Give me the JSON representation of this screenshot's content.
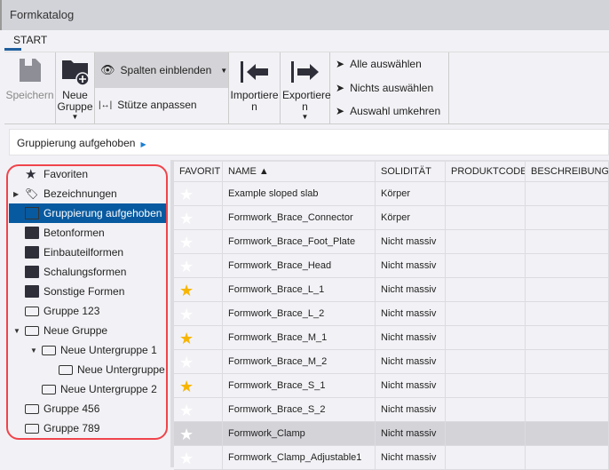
{
  "window": {
    "title": "Formkatalog"
  },
  "tabs": [
    {
      "label": "START"
    }
  ],
  "ribbon": {
    "save": "Speichern",
    "new_group": "Neue Gruppe",
    "show_columns": "Spalten einblenden",
    "fit_columns": "Stütze anpassen",
    "import": "Importiere n",
    "export": "Exportiere n",
    "select_all": "Alle auswählen",
    "select_none": "Nichts auswählen",
    "invert_selection": "Auswahl umkehren"
  },
  "breadcrumb": {
    "label": "Gruppierung aufgehoben"
  },
  "tree": [
    {
      "label": "Favoriten",
      "icon": "star-icon"
    },
    {
      "label": "Bezeichnungen",
      "icon": "tag-icon"
    },
    {
      "label": "Gruppierung aufgehoben",
      "icon": "ungroup-icon",
      "selected": true
    },
    {
      "label": "Betonformen",
      "icon": "folder-icon"
    },
    {
      "label": "Einbauteilformen",
      "icon": "folder-icon"
    },
    {
      "label": "Schalungsformen",
      "icon": "folder-icon"
    },
    {
      "label": "Sonstige Formen",
      "icon": "folder-icon"
    },
    {
      "label": "Gruppe 123",
      "icon": "open-folder-icon"
    },
    {
      "label": "Neue Gruppe",
      "icon": "open-folder-icon"
    },
    {
      "label": "Neue Untergruppe 1",
      "icon": "open-folder-icon"
    },
    {
      "label": "Neue Untergruppe",
      "icon": "open-folder-icon"
    },
    {
      "label": "Neue Untergruppe 2",
      "icon": "open-folder-icon"
    },
    {
      "label": "Gruppe 456",
      "icon": "open-folder-icon"
    },
    {
      "label": "Gruppe 789",
      "icon": "open-folder-icon"
    }
  ],
  "table": {
    "columns": [
      "FAVORIT",
      "NAME ▲",
      "SOLIDITÄT",
      "PRODUKTCODE",
      "BESCHREIBUNG"
    ],
    "rows": [
      {
        "fav": false,
        "name": "Example sloped slab",
        "solid": "Körper"
      },
      {
        "fav": false,
        "name": "Formwork_Brace_Connector",
        "solid": "Körper"
      },
      {
        "fav": false,
        "name": "Formwork_Brace_Foot_Plate",
        "solid": "Nicht massiv"
      },
      {
        "fav": false,
        "name": "Formwork_Brace_Head",
        "solid": "Nicht massiv"
      },
      {
        "fav": true,
        "name": "Formwork_Brace_L_1",
        "solid": "Nicht massiv"
      },
      {
        "fav": false,
        "name": "Formwork_Brace_L_2",
        "solid": "Nicht massiv"
      },
      {
        "fav": true,
        "name": "Formwork_Brace_M_1",
        "solid": "Nicht massiv"
      },
      {
        "fav": false,
        "name": "Formwork_Brace_M_2",
        "solid": "Nicht massiv"
      },
      {
        "fav": true,
        "name": "Formwork_Brace_S_1",
        "solid": "Nicht massiv"
      },
      {
        "fav": false,
        "name": "Formwork_Brace_S_2",
        "solid": "Nicht massiv"
      },
      {
        "fav": false,
        "name": "Formwork_Clamp",
        "solid": "Nicht massiv",
        "selected": true
      },
      {
        "fav": false,
        "name": "Formwork_Clamp_Adjustable1",
        "solid": "Nicht massiv"
      }
    ]
  },
  "colors": {
    "accent": "#075aa0",
    "star_on": "#f7b500",
    "star_off": "#ffffff",
    "highlight": "#f0444b"
  }
}
